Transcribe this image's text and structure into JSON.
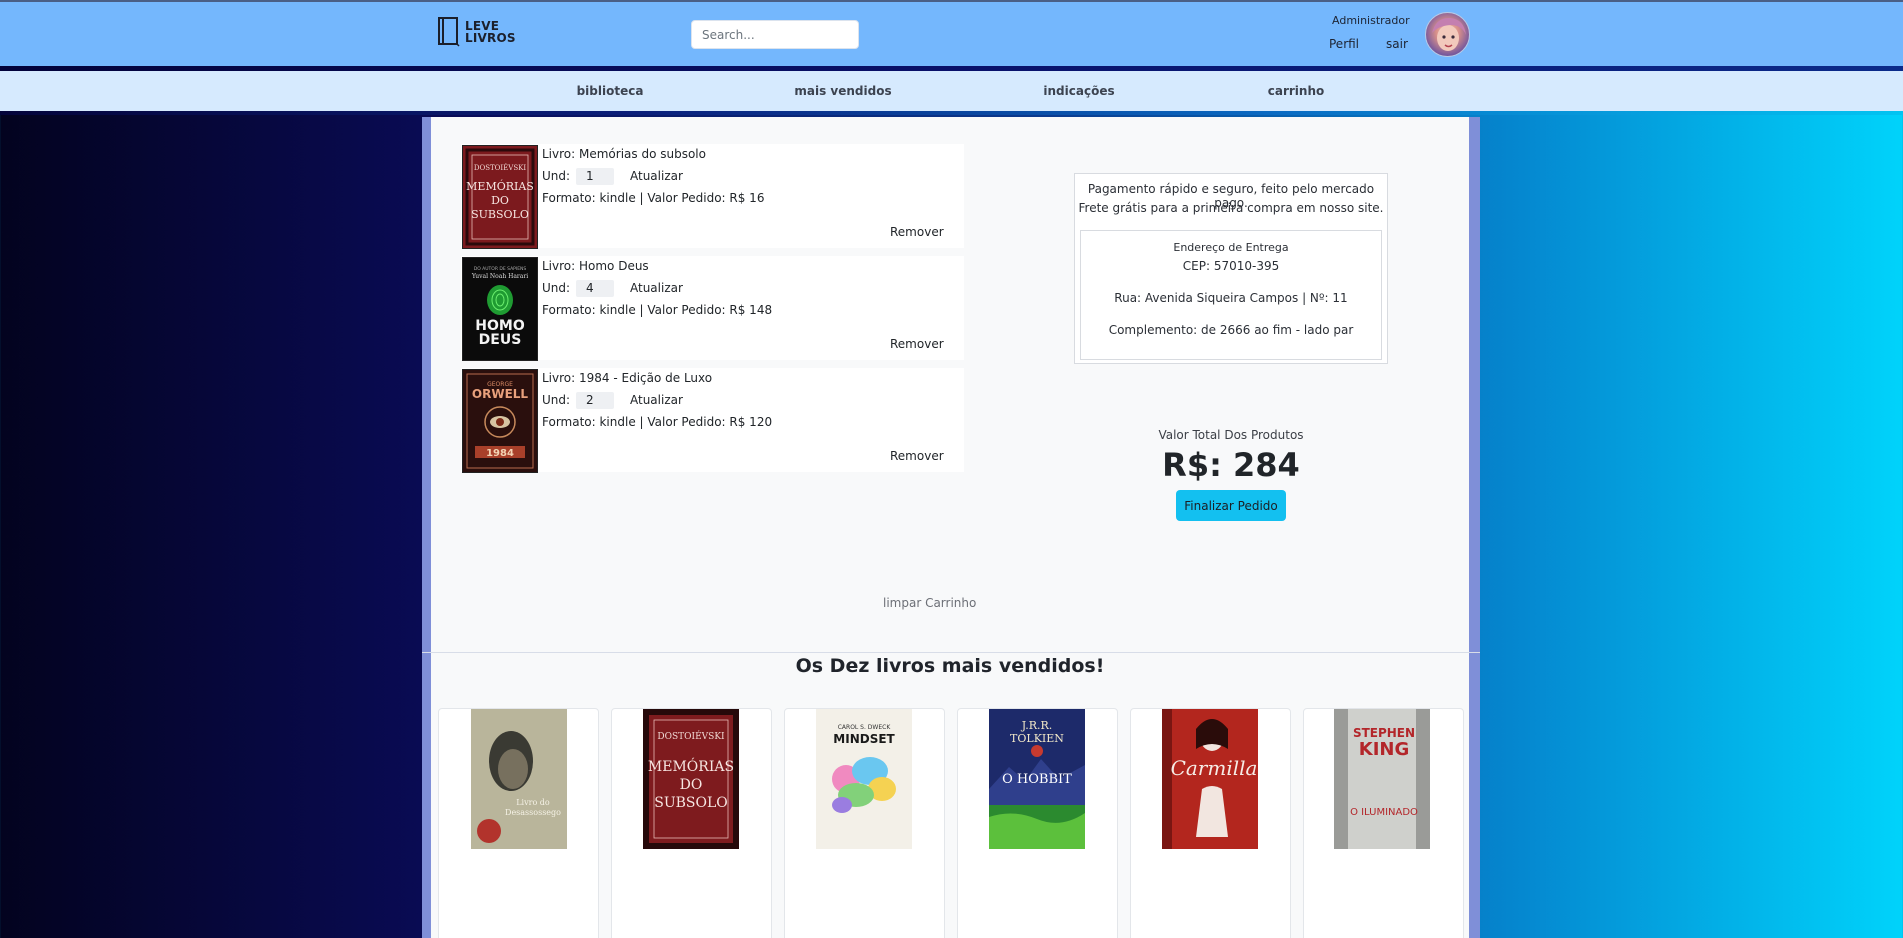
{
  "header": {
    "logo_line1": "LEVE",
    "logo_line2": "LIVROS",
    "search_placeholder": "Search...",
    "user_role": "Administrador",
    "profile_link": "Perfil",
    "logout_link": "sair"
  },
  "nav": {
    "items": [
      "biblioteca",
      "mais vendidos",
      "indicações",
      "carrinho"
    ]
  },
  "cart": {
    "items": [
      {
        "title": "Livro: Memórias do subsolo",
        "qty_label": "Und:",
        "qty": "1",
        "update": "Atualizar",
        "details": "Formato: kindle | Valor Pedido: R$ 16",
        "remove": "Remover"
      },
      {
        "title": "Livro: Homo Deus",
        "qty_label": "Und:",
        "qty": "4",
        "update": "Atualizar",
        "details": "Formato: kindle | Valor Pedido: R$ 148",
        "remove": "Remover"
      },
      {
        "title": "Livro: 1984 - Edição de Luxo",
        "qty_label": "Und:",
        "qty": "2",
        "update": "Atualizar",
        "details": "Formato: kindle | Valor Pedido: R$ 120",
        "remove": "Remover"
      }
    ],
    "clear": "limpar Carrinho"
  },
  "payment": {
    "line1": "Pagamento rápido e seguro, feito pelo mercado pago.",
    "line2": "Frete grátis para a primeira compra em nosso site.",
    "address_heading": "Endereço de Entrega",
    "cep": "CEP: 57010-395",
    "street": "Rua: Avenida Siqueira Campos | Nº: 11",
    "complement": "Complemento: de 2666 ao fim - lado par"
  },
  "summary": {
    "total_label": "Valor Total Dos Produtos",
    "total_value": "R$: 284",
    "checkout": "Finalizar Pedido"
  },
  "bestsellers": {
    "title": "Os Dez livros mais vendidos!",
    "covers": [
      "Livro do Desassossego",
      "Memórias do Subsolo",
      "Mindset",
      "O Hobbit",
      "Carmilla",
      "O Iluminado"
    ]
  },
  "colors": {
    "header_bg": "#74b7fd",
    "nav_bg": "#d6eafe",
    "checkout_button": "#13c0f0"
  }
}
